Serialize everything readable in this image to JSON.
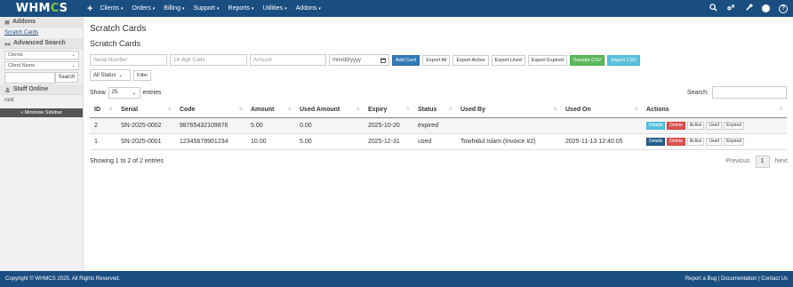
{
  "logo": {
    "text_a": "WHM",
    "text_o": "C",
    "text_b": "S"
  },
  "nav": {
    "plus": "+",
    "items": [
      "Clients",
      "Orders",
      "Billing",
      "Support",
      "Reports",
      "Utilities",
      "Addons"
    ],
    "caret": "▾"
  },
  "sidebar": {
    "addons_heading": "Addons",
    "addons_link": "Scratch Cards",
    "advanced_search_heading": "Advanced Search",
    "search_type": "Clients",
    "search_field": "Client Name",
    "search_button": "Search",
    "staff_online_heading": "Staff Online",
    "staff_user": "root",
    "minimise_button": "« Minimise Sidebar"
  },
  "main": {
    "page_title": "Scratch Cards",
    "sub_title": "Scratch Cards",
    "form": {
      "serial_placeholder": "Serial Number",
      "code_placeholder": "14-digit Code",
      "amount_placeholder": "Amount",
      "date_placeholder": "mm/dd/yyyy",
      "add_card": "Add Card",
      "export_all": "Export All",
      "export_active": "Export Active",
      "export_used": "Export Used",
      "export_expired": "Export Expired",
      "sample_csv": "Sample CSV",
      "import_csv": "Import CSV"
    },
    "filter": {
      "status_value": "All Status",
      "filter_button": "Filter"
    },
    "show": {
      "label_show": "Show",
      "page_size": "25",
      "label_entries": "entries",
      "search_label": "Search:"
    },
    "table": {
      "headers": [
        "ID",
        "Serial",
        "Code",
        "Amount",
        "Used Amount",
        "Expiry",
        "Status",
        "Used By",
        "Used On",
        "Actions"
      ],
      "rows": [
        {
          "id": "2",
          "serial": "SN-2025-0002",
          "code": "98765432109876",
          "amount": "5.00",
          "used_amount": "0.00",
          "expiry": "2025-10-20",
          "status": "expired",
          "used_by": "",
          "used_on": ""
        },
        {
          "id": "1",
          "serial": "SN-2025-0001",
          "code": "12345678901234",
          "amount": "10.00",
          "used_amount": "5.00",
          "expiry": "2025-12-31",
          "status": "used",
          "used_by": "Towhidul Islam (Invoice #2)",
          "used_on": "2025-11-13 12:40:05"
        }
      ],
      "action_labels": {
        "details": "Details",
        "delete": "Delete",
        "active": "Active",
        "used": "Used",
        "expired": "Expired"
      }
    },
    "info": "Showing 1 to 2 of 2 entries",
    "pager": {
      "previous": "Previous",
      "page": "1",
      "next": "Next"
    }
  },
  "footer": {
    "copyright": "Copyright © WHMCS 2025. All Rights Reserved.",
    "links": "Report a Bug | Documentation | Contact Us"
  },
  "colors": {
    "nav_bg": "#1a4d80",
    "primary": "#337ab7",
    "success": "#5cb85c",
    "info": "#5bc0de",
    "danger": "#d9534f"
  }
}
